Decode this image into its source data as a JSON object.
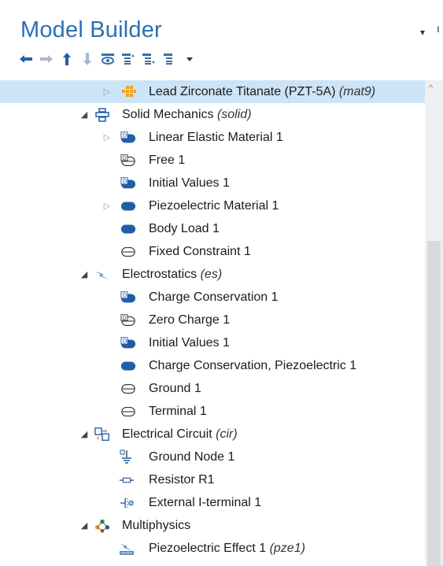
{
  "header": {
    "title": "Model Builder",
    "menu_glyph": "▾",
    "edge_glyph": "ı"
  },
  "toolbar": {
    "items": [
      {
        "icon": "arrow-left-icon"
      },
      {
        "icon": "arrow-right-icon"
      },
      {
        "icon": "arrow-up-icon"
      },
      {
        "icon": "arrow-down-icon"
      },
      {
        "icon": "show-icon"
      },
      {
        "icon": "collapse-icon"
      },
      {
        "icon": "expand-icon"
      },
      {
        "icon": "list-icon"
      },
      {
        "icon": "dropdown-icon"
      }
    ]
  },
  "tree": {
    "items": [
      {
        "label": "Lead Zirconate Titanate (PZT-5A)",
        "tag": "(mat9)",
        "icon": "material-icon",
        "twisty": "closed",
        "selected": true
      },
      {
        "label": "Solid Mechanics",
        "tag": "(solid)",
        "icon": "solid-mechanics-icon",
        "twisty": "open"
      },
      {
        "label": "Linear Elastic Material 1",
        "tag": "",
        "icon": "domain-default-icon",
        "twisty": "closed"
      },
      {
        "label": "Free 1",
        "tag": "",
        "icon": "boundary-default-icon",
        "twisty": ""
      },
      {
        "label": "Initial Values 1",
        "tag": "",
        "icon": "domain-default-icon",
        "twisty": ""
      },
      {
        "label": "Piezoelectric Material 1",
        "tag": "",
        "icon": "domain-icon",
        "twisty": "closed"
      },
      {
        "label": "Body Load 1",
        "tag": "",
        "icon": "domain-icon",
        "twisty": ""
      },
      {
        "label": "Fixed Constraint 1",
        "tag": "",
        "icon": "boundary-icon",
        "twisty": ""
      },
      {
        "label": "Electrostatics",
        "tag": "(es)",
        "icon": "electrostatics-icon",
        "twisty": "open"
      },
      {
        "label": "Charge Conservation 1",
        "tag": "",
        "icon": "domain-default-icon",
        "twisty": ""
      },
      {
        "label": "Zero Charge 1",
        "tag": "",
        "icon": "boundary-default-icon",
        "twisty": ""
      },
      {
        "label": "Initial Values 1",
        "tag": "",
        "icon": "domain-default-icon",
        "twisty": ""
      },
      {
        "label": "Charge Conservation, Piezoelectric 1",
        "tag": "",
        "icon": "domain-icon",
        "twisty": ""
      },
      {
        "label": "Ground 1",
        "tag": "",
        "icon": "boundary-icon",
        "twisty": ""
      },
      {
        "label": "Terminal 1",
        "tag": "",
        "icon": "boundary-icon",
        "twisty": ""
      },
      {
        "label": "Electrical Circuit",
        "tag": "(cir)",
        "icon": "circuit-icon",
        "twisty": "open"
      },
      {
        "label": "Ground Node 1",
        "tag": "",
        "icon": "ground-node-icon",
        "twisty": ""
      },
      {
        "label": "Resistor R1",
        "tag": "",
        "icon": "resistor-icon",
        "twisty": ""
      },
      {
        "label": "External I-terminal 1",
        "tag": "",
        "icon": "external-terminal-icon",
        "twisty": ""
      },
      {
        "label": "Multiphysics",
        "tag": "",
        "icon": "multiphysics-icon",
        "twisty": "open"
      },
      {
        "label": "Piezoelectric Effect 1",
        "tag": "(pze1)",
        "icon": "piezo-effect-icon",
        "twisty": ""
      }
    ]
  },
  "colors": {
    "title": "#2c6fb6",
    "selection": "#cce4f7",
    "node_blue": "#1f5fa8",
    "material_orange": "#f0a020"
  }
}
